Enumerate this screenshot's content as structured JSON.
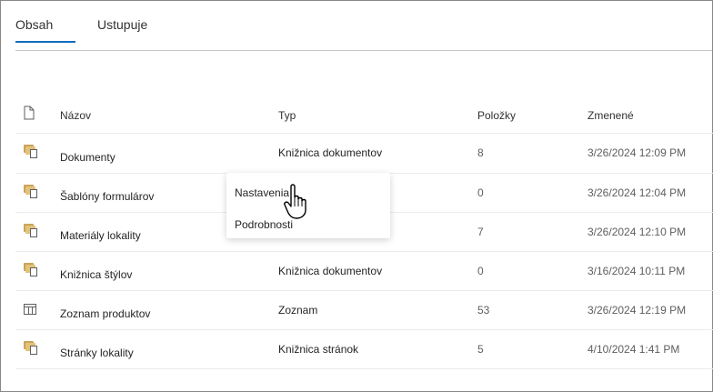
{
  "tabs": [
    {
      "label": "Obsah"
    },
    {
      "label": "Ustupuje"
    }
  ],
  "columns": {
    "name": "Názov",
    "type": "Typ",
    "items": "Položky",
    "modified": "Zmenené"
  },
  "rows": [
    {
      "name": "Dokumenty",
      "type": "Knižnica dokumentov",
      "items": "8",
      "modified": "3/26/2024 12:09 PM",
      "icon": "library-icon"
    },
    {
      "name": "Šablóny formulárov",
      "type": "",
      "items": "0",
      "modified": "3/26/2024 12:04 PM",
      "icon": "library-icon"
    },
    {
      "name": "Materiály lokality",
      "type": "",
      "items": "7",
      "modified": "3/26/2024 12:10 PM",
      "icon": "library-icon"
    },
    {
      "name": "Knižnica štýlov",
      "type": "Knižnica dokumentov",
      "items": "0",
      "modified": "3/16/2024 10:11 PM",
      "icon": "library-icon"
    },
    {
      "name": "Zoznam produktov",
      "type": "Zoznam",
      "items": "53",
      "modified": "3/26/2024 12:19 PM",
      "icon": "list-icon"
    },
    {
      "name": "Stránky lokality",
      "type": "Knižnica stránok",
      "items": "5",
      "modified": "4/10/2024 1:41 PM",
      "icon": "library-icon"
    }
  ],
  "context_menu": {
    "settings": "Nastavenia",
    "details": "Podrobnosti"
  },
  "colors": {
    "accent": "#0f6cbd",
    "folder": "#e3c27a"
  }
}
